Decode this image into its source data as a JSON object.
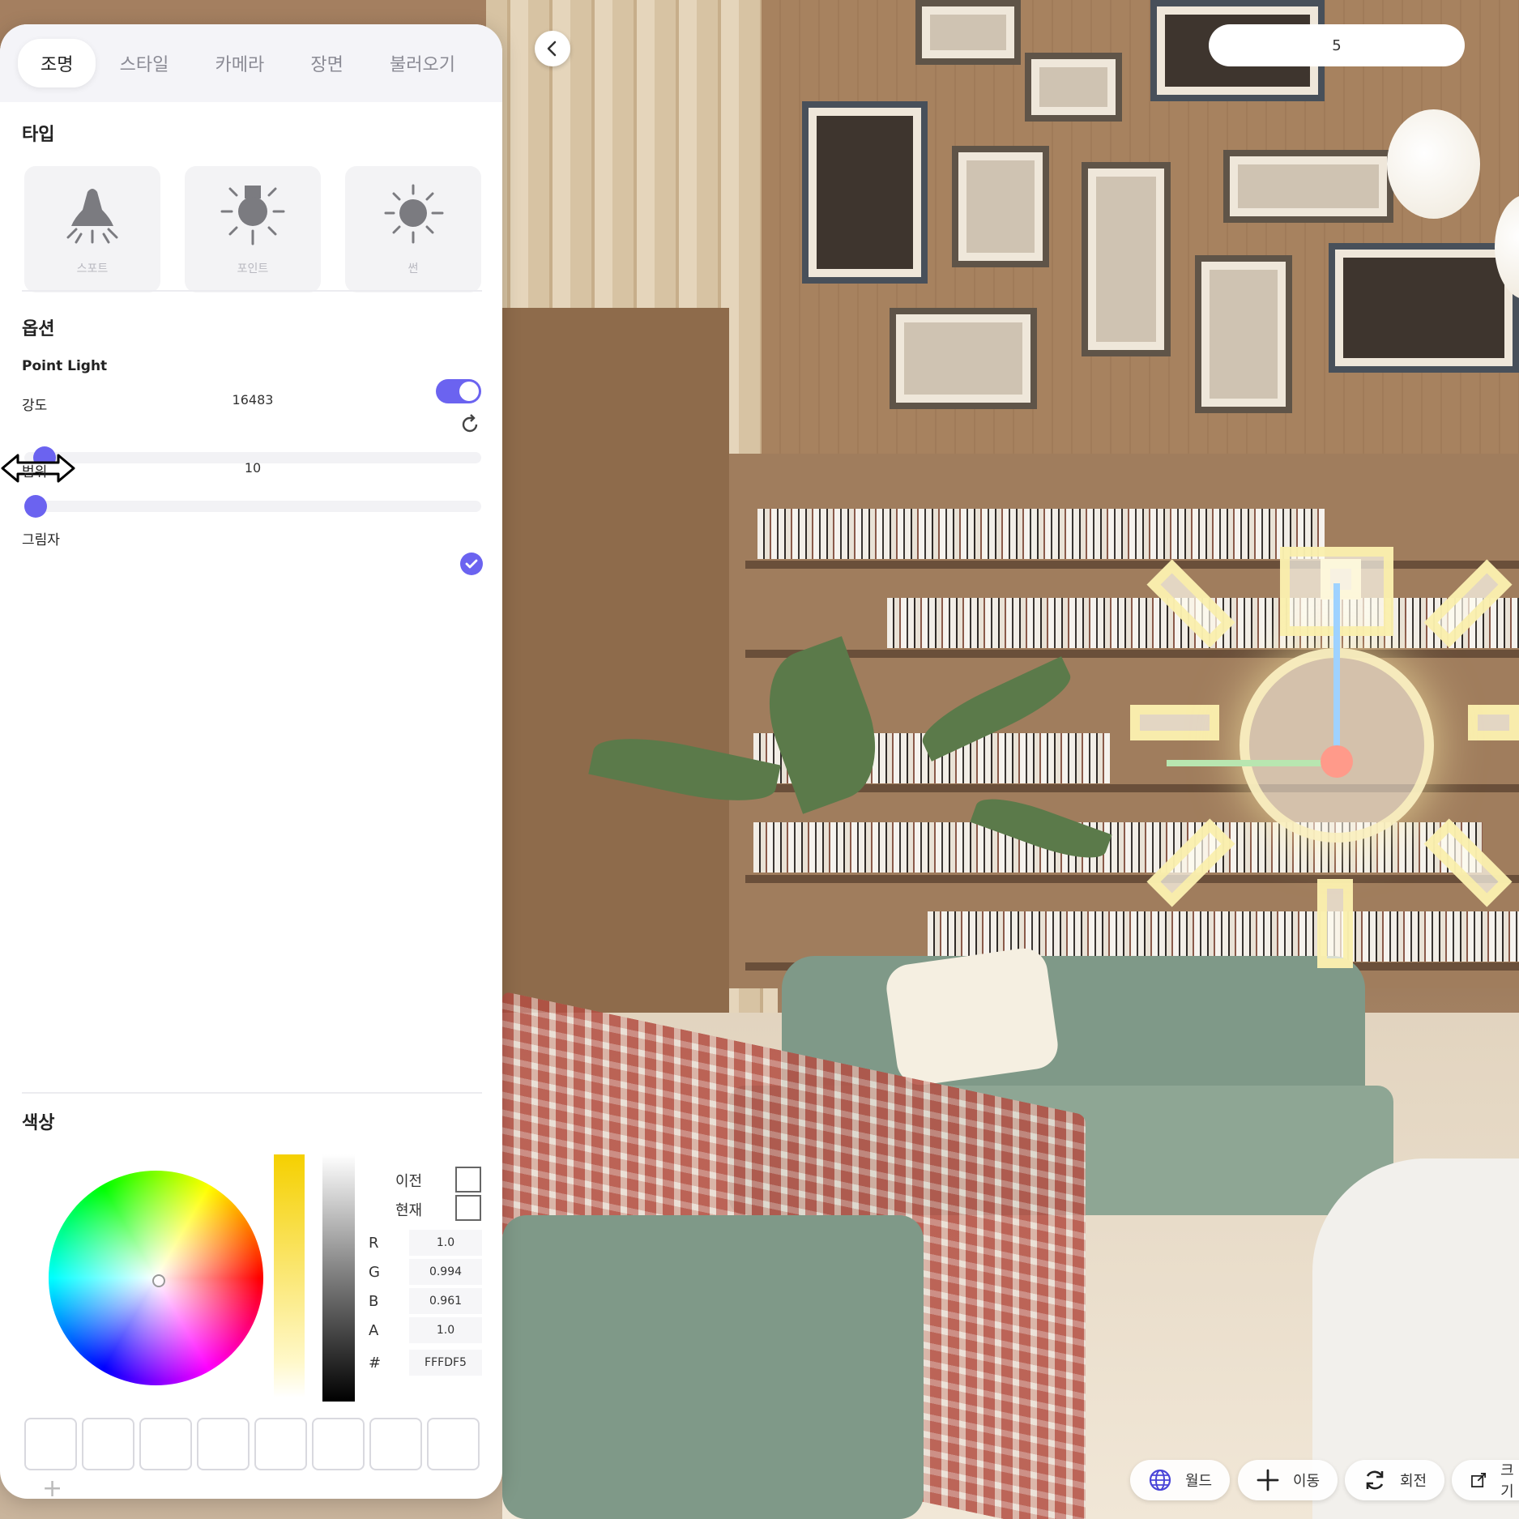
{
  "tabs": [
    {
      "label": "조명",
      "active": true
    },
    {
      "label": "스타일"
    },
    {
      "label": "카메라"
    },
    {
      "label": "장면"
    },
    {
      "label": "불러오기"
    }
  ],
  "type_section": {
    "title": "타입",
    "items": [
      {
        "label": "스포트",
        "icon": "spot-light-icon"
      },
      {
        "label": "포인트",
        "icon": "point-light-icon"
      },
      {
        "label": "썬",
        "icon": "sun-icon"
      }
    ]
  },
  "options": {
    "title": "옵션",
    "point_light_label": "Point Light",
    "point_light_on": true,
    "intensity_label": "강도",
    "intensity_value": "16483",
    "intensity_fraction": 0.02,
    "range_label": "범위",
    "range_value": "10",
    "range_fraction": 0.0,
    "shadow_label": "그림자",
    "shadow_checked": true
  },
  "color": {
    "title": "색상",
    "previous_label": "이전",
    "current_label": "현재",
    "channels": [
      {
        "label": "R",
        "value": "1.0"
      },
      {
        "label": "G",
        "value": "0.994"
      },
      {
        "label": "B",
        "value": "0.961"
      },
      {
        "label": "A",
        "value": "1.0"
      },
      {
        "label": "#",
        "value": "FFFDF5"
      }
    ],
    "accent": "#6b63f0"
  },
  "viewport": {
    "counter": "5",
    "tools": [
      {
        "label": "월드",
        "icon": "globe-icon"
      },
      {
        "label": "이동",
        "icon": "move-icon"
      },
      {
        "label": "회전",
        "icon": "rotate-icon"
      },
      {
        "label": "크기",
        "icon": "scale-icon"
      }
    ]
  }
}
